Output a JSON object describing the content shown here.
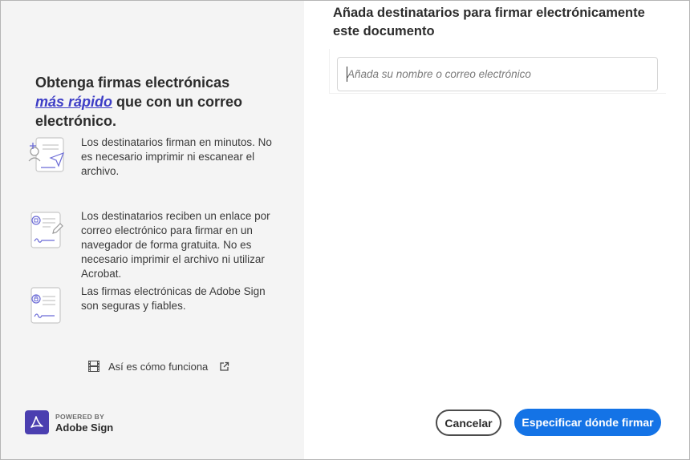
{
  "left_panel": {
    "headline": {
      "before": "Obtenga firmas electrónicas",
      "link": "más rápido",
      "after": " que con un correo electrónico."
    },
    "features": [
      {
        "icon": "send-document-icon",
        "text": "Los destinatarios firman en minutos. No es necesario imprimir ni escanear el archivo."
      },
      {
        "icon": "sign-document-icon",
        "text": "Los destinatarios reciben un enlace por correo electrónico para firmar en un navegador de forma gratuita. No es necesario imprimir el archivo ni utilizar Acrobat."
      },
      {
        "icon": "secure-document-icon",
        "text": "Las firmas electrónicas de Adobe Sign son seguras y fiables."
      }
    ],
    "how_it_works": "Así es cómo funciona",
    "brand": {
      "powered_by": "POWERED BY",
      "product": "Adobe Sign"
    }
  },
  "right_panel": {
    "title": "Añada destinatarios para firmar electrónicamente este documento",
    "recipient_input": {
      "value": "",
      "placeholder": "Añada su nombre o correo electrónico"
    },
    "cancel_label": "Cancelar",
    "primary_label": "Especificar dónde firmar"
  },
  "colors": {
    "accent_link": "#3d3dc6",
    "primary_button": "#1473e6",
    "brand_logo": "#4b3fb0",
    "left_background": "#f4f4f4"
  }
}
